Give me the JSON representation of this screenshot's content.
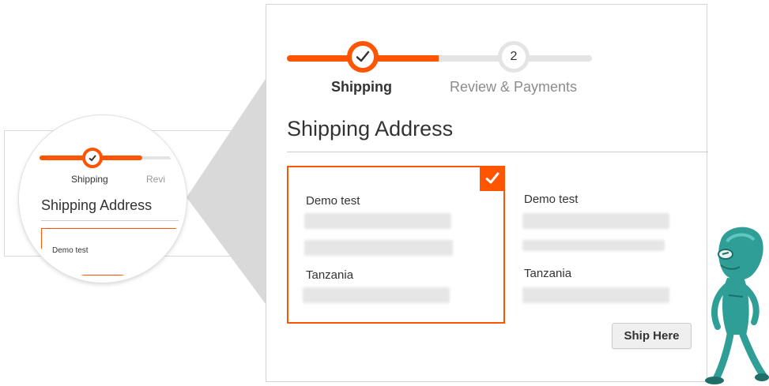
{
  "zoom_preview": {
    "step1_label": "Shipping",
    "step2_label_partial": "Revi",
    "section_title": "Shipping Address",
    "address_name": "Demo test"
  },
  "progress": {
    "step1": {
      "label": "Shipping",
      "state": "completed",
      "icon": "check-icon"
    },
    "step2": {
      "label": "Review & Payments",
      "number": "2",
      "state": "upcoming"
    }
  },
  "shipping": {
    "title": "Shipping Address",
    "addresses": [
      {
        "name": "Demo test",
        "country": "Tanzania",
        "selected": true
      },
      {
        "name": "Demo test",
        "country": "Tanzania",
        "selected": false
      }
    ],
    "ship_here_label": "Ship Here"
  },
  "colors": {
    "accent": "#ff5501",
    "track_inactive": "#e4e4e4",
    "mascot": "#2e9e96"
  }
}
